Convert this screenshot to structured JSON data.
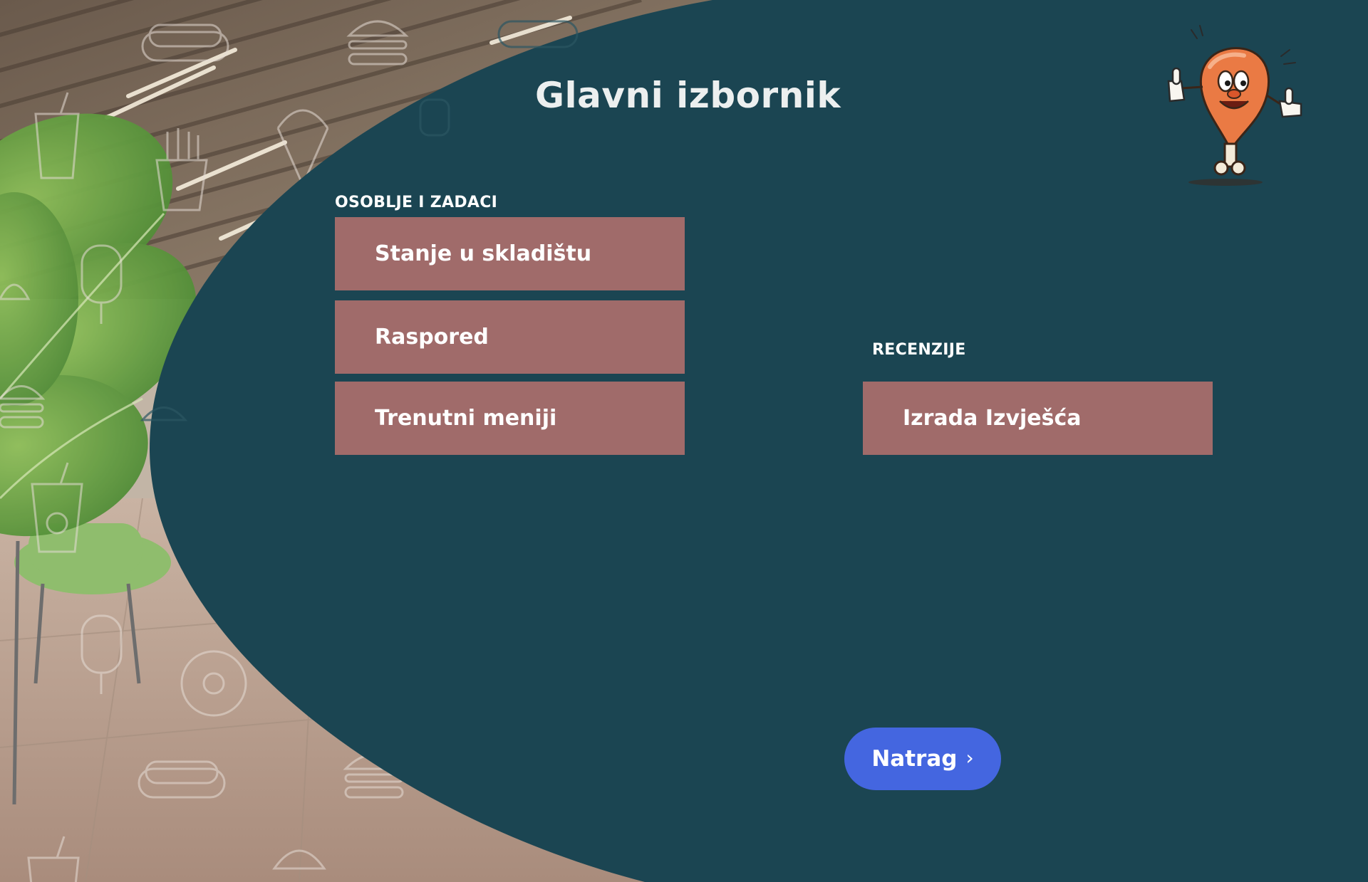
{
  "page": {
    "title": "Glavni izbornik"
  },
  "sections": {
    "staff": {
      "label": "OSOBLJE I ZADACI",
      "items": [
        {
          "label": "Stanje u skladištu"
        },
        {
          "label": "Raspored"
        },
        {
          "label": "Trenutni meniji"
        }
      ]
    },
    "reviews": {
      "label": "RECENZIJE",
      "items": [
        {
          "label": "Izrada Izvješća"
        }
      ]
    }
  },
  "navigation": {
    "back_label": "Natrag",
    "back_icon": "chevron-right-icon"
  },
  "decor": {
    "mascot": "chicken-drumstick-mascot",
    "background_icons": [
      "burger-icon",
      "hotdog-icon",
      "fries-icon",
      "ice-cream-icon",
      "popsicle-icon",
      "soda-cup-icon",
      "donut-icon",
      "taco-icon"
    ]
  },
  "colors": {
    "panel": "#1b4552",
    "menu_button": "#a06b6a",
    "back_button": "#4466e0",
    "title_text": "#ecefef"
  }
}
